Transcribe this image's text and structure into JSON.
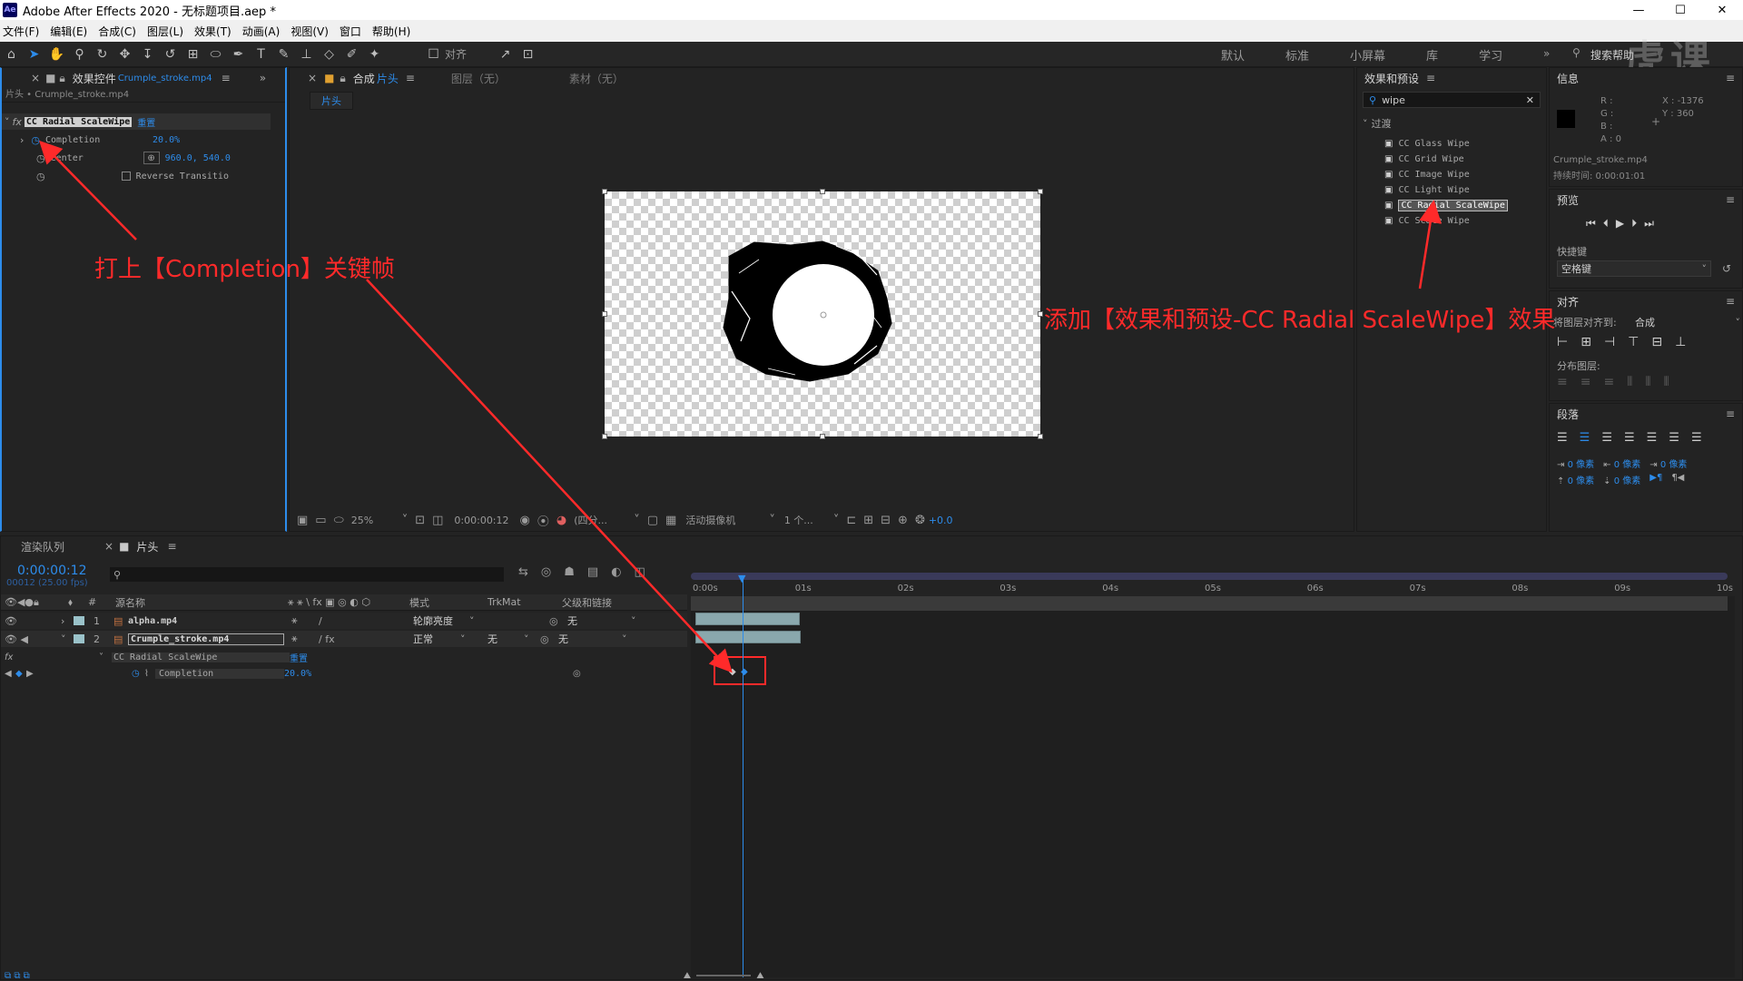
{
  "title_bar": {
    "logo": "Ae",
    "title": "Adobe After Effects 2020 - 无标题项目.aep *",
    "controls": [
      "—",
      "☐",
      "✕"
    ]
  },
  "menu": [
    "文件(F)",
    "编辑(E)",
    "合成(C)",
    "图层(L)",
    "效果(T)",
    "动画(A)",
    "视图(V)",
    "窗口",
    "帮助(H)"
  ],
  "toolbar": {
    "align_label": "对齐",
    "workspaces": [
      "默认",
      "标准",
      "小屏幕",
      "库",
      "学习"
    ],
    "search_help": "搜索帮助",
    "watermark": "虎课网"
  },
  "effect_controls": {
    "tab_label": "效果控件",
    "tab_file": "Crumple_stroke.mp4",
    "breadcrumb": "片头 • Crumple_stroke.mp4",
    "effect_name": "CC Radial ScaleWipe",
    "reset_label": "重置",
    "props": [
      {
        "name": "Completion",
        "value": "20.0%"
      },
      {
        "name": "Center",
        "value": "960.0, 540.0"
      },
      {
        "name": "Reverse Transitio",
        "value": ""
      }
    ]
  },
  "composition": {
    "tab_prefix": "合成",
    "tab_name": "片头",
    "layer_tab": "图层（无）",
    "footage_tab": "素材（无）",
    "comp_chip": "片头",
    "footer": {
      "zoom": "25%",
      "time": "0:00:00:12",
      "resolution": "(四分...",
      "camera": "活动摄像机",
      "views": "1 个...",
      "exposure": "+0.0"
    }
  },
  "effects_presets": {
    "title": "效果和预设",
    "search": "wipe",
    "category": "过渡",
    "items": [
      "CC Glass Wipe",
      "CC Grid Wipe",
      "CC Image Wipe",
      "CC Light Wipe",
      "CC Radial ScaleWipe",
      "CC Scale Wipe"
    ],
    "selected_index": 4
  },
  "info_panel": {
    "title": "信息",
    "rgba": [
      "R :",
      "G :",
      "B :",
      "A : 0"
    ],
    "coords": [
      "X : -1376",
      "Y : 360"
    ],
    "file": "Crumple_stroke.mp4",
    "duration": "持续时间: 0:00:01:01"
  },
  "preview_panel": {
    "title": "预览",
    "shortcut_label": "快捷键",
    "shortcut_value": "空格键"
  },
  "align_panel": {
    "title": "对齐",
    "align_to_label": "将图层对齐到:",
    "align_to_value": "合成",
    "distribute_label": "分布图层:"
  },
  "paragraph_panel": {
    "title": "段落",
    "indent_values": [
      "0 像素",
      "0 像素",
      "0 像素",
      "0 像素",
      "0 像素"
    ]
  },
  "timeline": {
    "render_queue_tab": "渲染队列",
    "comp_tab": "片头",
    "timecode": "0:00:00:12",
    "fps": "00012 (25.00 fps)",
    "columns": {
      "source": "源名称",
      "mode": "模式",
      "trkmat": "TrkMat",
      "parent": "父级和链接"
    },
    "layers": [
      {
        "num": "1",
        "name": "alpha.mp4",
        "mode": "轮廓亮度",
        "trkmat": "",
        "parent": "无"
      },
      {
        "num": "2",
        "name": "Crumple_stroke.mp4",
        "mode": "正常",
        "trkmat": "无",
        "parent": "无"
      }
    ],
    "effect_row": {
      "name": "CC Radial ScaleWipe",
      "reset": "重置"
    },
    "property_row": {
      "name": "Completion",
      "value": "20.0%"
    },
    "ruler": [
      "0:00s",
      "01s",
      "02s",
      "03s",
      "04s",
      "05s",
      "06s",
      "07s",
      "08s",
      "09s",
      "10s"
    ]
  },
  "annotations": {
    "left": "打上【Completion】关键帧",
    "right": "添加【效果和预设-CC Radial ScaleWipe】效果",
    "color": "#ff2a2a"
  }
}
